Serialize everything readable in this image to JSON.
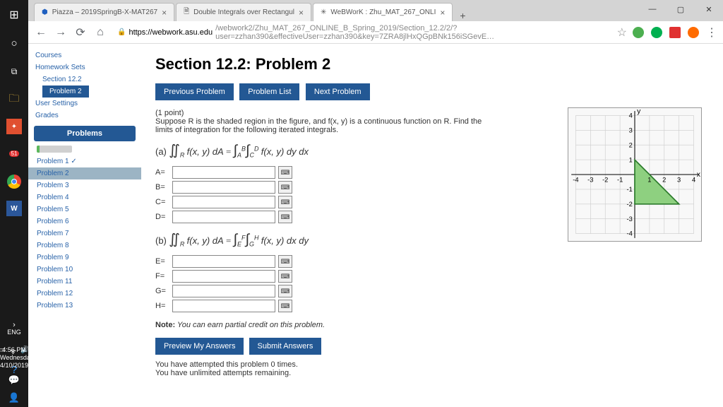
{
  "tabs": [
    {
      "label": "Piazza – 2019SpringB-X-MAT267"
    },
    {
      "label": "Double Integrals over Rectangul"
    },
    {
      "label": "WeBWorK : Zhu_MAT_267_ONLI"
    }
  ],
  "url": {
    "domain": "https://webwork.asu.edu",
    "path": "/webwork2/Zhu_MAT_267_ONLINE_B_Spring_2019/Section_12.2/2/?user=zzhan390&effectiveUser=zzhan390&key=7ZRA8jlHxQGpBNk156iSGevE…"
  },
  "sidebar": {
    "courses": "Courses",
    "homework": "Homework Sets",
    "section": "Section 12.2",
    "current": "Problem 2",
    "user_settings": "User Settings",
    "grades": "Grades",
    "problems_header": "Problems",
    "problems": [
      {
        "label": "Problem 1 ✓"
      },
      {
        "label": "Problem 2"
      },
      {
        "label": "Problem 3"
      },
      {
        "label": "Problem 4"
      },
      {
        "label": "Problem 5"
      },
      {
        "label": "Problem 6"
      },
      {
        "label": "Problem 7"
      },
      {
        "label": "Problem 8"
      },
      {
        "label": "Problem 9"
      },
      {
        "label": "Problem 10"
      },
      {
        "label": "Problem 11"
      },
      {
        "label": "Problem 12"
      },
      {
        "label": "Problem 13"
      }
    ]
  },
  "main": {
    "title": "Section 12.2: Problem 2",
    "prev": "Previous Problem",
    "list": "Problem List",
    "next": "Next Problem",
    "points": "(1 point)",
    "prompt": "Suppose R is the shaded region in the figure, and f(x, y) is a continuous function on R. Find the limits of integration for the following iterated integrals.",
    "part_a": "(a)",
    "part_b": "(b)",
    "labels": {
      "A": "A=",
      "B": "B=",
      "C": "C=",
      "D": "D=",
      "E": "E=",
      "F": "F=",
      "G": "G=",
      "H": "H="
    },
    "note_label": "Note:",
    "note_text": " You can earn partial credit on this problem.",
    "preview": "Preview My Answers",
    "submit": "Submit Answers",
    "attempts1": "You have attempted this problem 0 times.",
    "attempts2": "You have unlimited attempts remaining."
  },
  "clock": {
    "time": "4:56 PM",
    "day": "Wednesday",
    "date": "4/10/2019",
    "lang": "ENG"
  },
  "chart_data": {
    "type": "region-plot",
    "xlim": [
      -4,
      4
    ],
    "ylim": [
      -4,
      4
    ],
    "shaded_region_vertices": [
      [
        0,
        1
      ],
      [
        0,
        -2
      ],
      [
        3,
        -2
      ]
    ],
    "description": "Triangle with vertices (0,1),(0,-2),(3,-2) shaded green on grid"
  }
}
